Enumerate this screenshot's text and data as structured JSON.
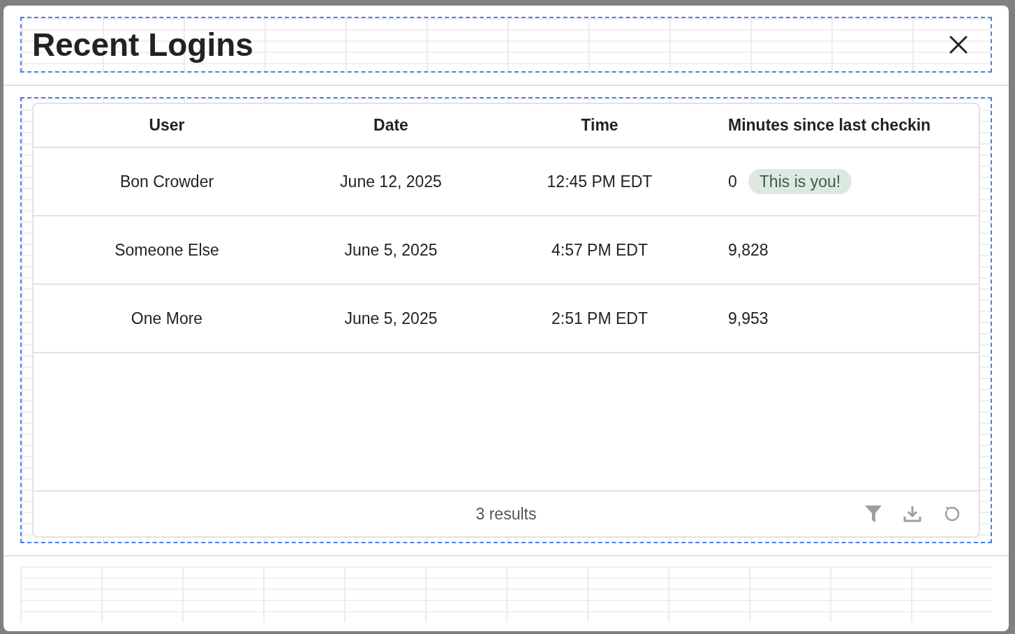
{
  "dialog": {
    "title": "Recent Logins"
  },
  "table": {
    "columns": [
      "User",
      "Date",
      "Time",
      "Minutes since last checkin"
    ],
    "rows": [
      {
        "user": "Bon Crowder",
        "date": "June 12, 2025",
        "time": "12:45 PM EDT",
        "minutes": "0",
        "badge": "This is you!"
      },
      {
        "user": "Someone Else",
        "date": "June 5, 2025",
        "time": "4:57 PM EDT",
        "minutes": "9,828"
      },
      {
        "user": "One More",
        "date": "June 5, 2025",
        "time": "2:51 PM EDT",
        "minutes": "9,953"
      }
    ],
    "footer": {
      "count": "3 results"
    }
  }
}
